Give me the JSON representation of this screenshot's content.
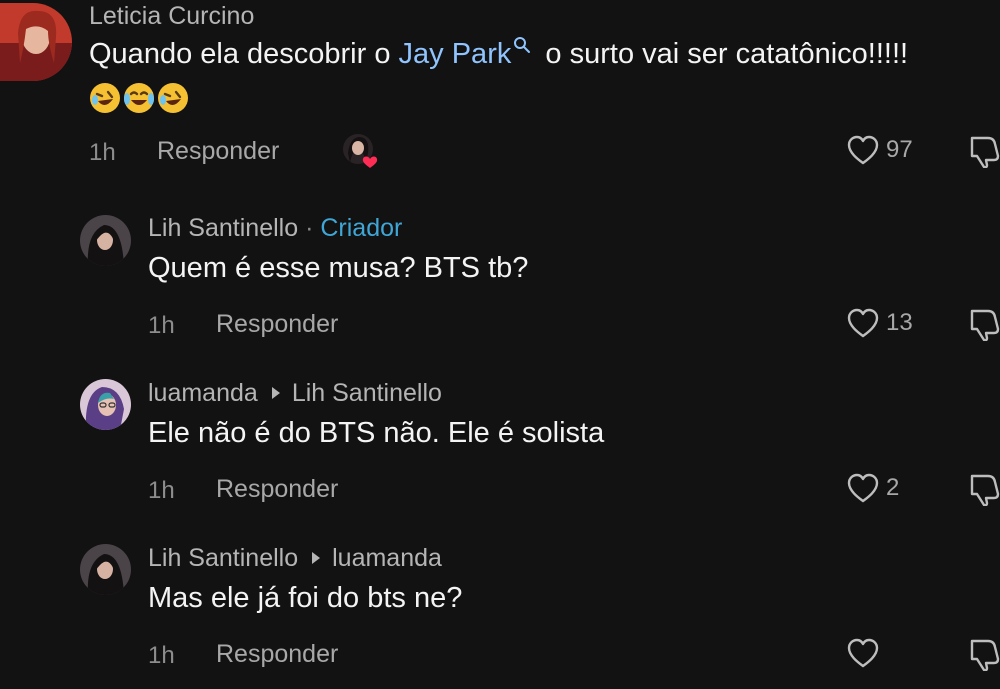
{
  "comments": [
    {
      "author": "Leticia Curcino",
      "text_before": "Quando ela descobrir o ",
      "mention": "Jay Park",
      "text_after": " o surto vai ser catatônico!!!!!",
      "emojis": [
        "rolling-on-floor-laughing",
        "tears-of-joy",
        "rolling-on-floor-laughing"
      ],
      "time": "1h",
      "reply_label": "Responder",
      "likes": "97",
      "liked_by_creator": true
    },
    {
      "author": "Lih Santinello",
      "separator": "·",
      "badge": "Criador",
      "text": "Quem é esse musa? BTS tb?",
      "time": "1h",
      "reply_label": "Responder",
      "likes": "13"
    },
    {
      "author": "luamanda",
      "reply_to": "Lih Santinello",
      "text": "Ele não é do BTS não. Ele é solista",
      "time": "1h",
      "reply_label": "Responder",
      "likes": "2"
    },
    {
      "author": "Lih Santinello",
      "reply_to": "luamanda",
      "text": "Mas ele já foi do bts ne?",
      "time": "1h",
      "reply_label": "Responder",
      "likes": ""
    }
  ],
  "icons": {
    "like": "heart-outline-icon",
    "dislike": "thumbs-down-outline-icon",
    "search": "search-icon",
    "creator_heart": "red-heart-icon"
  },
  "colors": {
    "background": "#121212",
    "mention": "#8fc4ff",
    "badge": "#3fa6d6",
    "creator_heart": "#ff2d55"
  }
}
